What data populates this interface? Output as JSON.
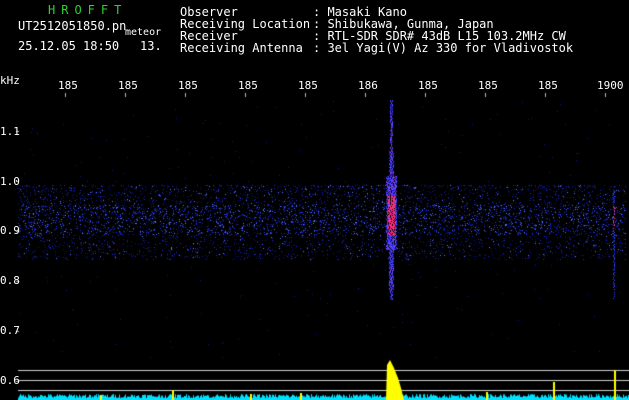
{
  "header": {
    "brand": "HROFFT",
    "filename": "UT2512051850.pn",
    "date_time": "25.12.05 18:50",
    "counter": "13.",
    "tag": "meteor",
    "fields": [
      {
        "label": "Observer",
        "value": ": Masaki Kano"
      },
      {
        "label": "Receiving Location",
        "value": ": Shibukawa, Gunma, Japan"
      },
      {
        "label": "Receiver",
        "value": ": RTL-SDR SDR# 43dB L15 103.2MHz CW"
      },
      {
        "label": "Receiving Antenna",
        "value": ": 3el Yagi(V) Az 330 for Vladivostok"
      }
    ]
  },
  "axis": {
    "unit": "kHz",
    "y_ticks": [
      "1.1",
      "1.0",
      "0.9",
      "0.8",
      "0.7",
      "0.6"
    ],
    "x_ticks": [
      "185",
      "185",
      "185",
      "185",
      "185",
      "186",
      "185",
      "185",
      "185",
      "1900"
    ]
  },
  "colors": {
    "background": "#000000",
    "noise_blue": "#2a3cff",
    "hot_magenta": "#ff2d7a",
    "amplitude_yellow": "#ffff00",
    "baseline_cyan": "#00e0ff",
    "header_green": "#2bd32b"
  }
}
